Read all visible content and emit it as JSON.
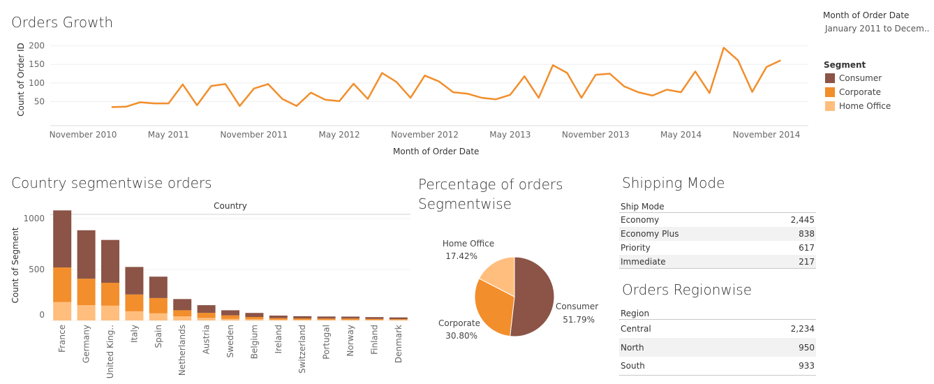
{
  "growth": {
    "title": "Orders Growth",
    "ylabel": "Count of Order ID",
    "xlabel": "Month of Order Date",
    "yticks": [
      200,
      150,
      100,
      50
    ],
    "xticks": [
      "November 2010",
      "May 2011",
      "November 2011",
      "May 2012",
      "November 2012",
      "May 2013",
      "November 2013",
      "May 2014",
      "November 2014"
    ]
  },
  "filter": {
    "title": "Month of Order Date",
    "value": "January 2011 to Decem.."
  },
  "legend": {
    "title": "Segment",
    "items": [
      {
        "label": "Consumer",
        "color": "#8b5446"
      },
      {
        "label": "Corporate",
        "color": "#f28e2b"
      },
      {
        "label": "Home Office",
        "color": "#ffbe7d"
      }
    ]
  },
  "country": {
    "title": "Country segmentwise orders",
    "header": "Country",
    "ylabel": "Count of Segment",
    "yticks": [
      1000,
      500,
      0
    ]
  },
  "pie": {
    "title_line1": "Percentage of orders",
    "title_line2": "Segmentwise",
    "labels": [
      {
        "name": "Home Office",
        "pct": "17.42%"
      },
      {
        "name": "Consumer",
        "pct": "51.79%"
      },
      {
        "name": "Corporate",
        "pct": "30.80%"
      }
    ]
  },
  "shipping": {
    "title": "Shipping Mode",
    "header": "Ship Mode",
    "rows": [
      {
        "mode": "Economy",
        "count": "2,445"
      },
      {
        "mode": "Economy Plus",
        "count": "838"
      },
      {
        "mode": "Priority",
        "count": "617"
      },
      {
        "mode": "Immediate",
        "count": "217"
      }
    ]
  },
  "region": {
    "title": "Orders Regionwise",
    "header": "Region",
    "rows": [
      {
        "region": "Central",
        "count": "2,234"
      },
      {
        "region": "North",
        "count": "950"
      },
      {
        "region": "South",
        "count": "933"
      }
    ]
  },
  "chart_data": [
    {
      "type": "line",
      "title": "Orders Growth",
      "xlabel": "Month of Order Date",
      "ylabel": "Count of Order ID",
      "ylim": [
        0,
        220
      ],
      "x": [
        "2011-01",
        "2011-02",
        "2011-03",
        "2011-04",
        "2011-05",
        "2011-06",
        "2011-07",
        "2011-08",
        "2011-09",
        "2011-10",
        "2011-11",
        "2011-12",
        "2012-01",
        "2012-02",
        "2012-03",
        "2012-04",
        "2012-05",
        "2012-06",
        "2012-07",
        "2012-08",
        "2012-09",
        "2012-10",
        "2012-11",
        "2012-12",
        "2013-01",
        "2013-02",
        "2013-03",
        "2013-04",
        "2013-05",
        "2013-06",
        "2013-07",
        "2013-08",
        "2013-09",
        "2013-10",
        "2013-11",
        "2013-12",
        "2014-01",
        "2014-02",
        "2014-03",
        "2014-04",
        "2014-05",
        "2014-06",
        "2014-07",
        "2014-08",
        "2014-09",
        "2014-10",
        "2014-11",
        "2014-12"
      ],
      "series": [
        {
          "values": [
            35,
            36,
            48,
            45,
            45,
            96,
            40,
            92,
            97,
            38,
            85,
            97,
            57,
            38,
            74,
            55,
            51,
            98,
            57,
            127,
            103,
            60,
            120,
            104,
            75,
            71,
            60,
            56,
            68,
            118,
            60,
            148,
            127,
            60,
            122,
            125,
            91,
            75,
            66,
            82,
            75,
            131,
            73,
            195,
            161,
            76,
            143,
            161
          ]
        }
      ]
    },
    {
      "type": "bar",
      "title": "Country segmentwise orders",
      "ylabel": "Count of Segment",
      "ylim": [
        0,
        1050
      ],
      "categories": [
        "France",
        "Germany",
        "United King..",
        "Italy",
        "Spain",
        "Netherlands",
        "Austria",
        "Sweden",
        "Belgium",
        "Ireland",
        "Switzerland",
        "Portugal",
        "Norway",
        "Finland",
        "Denmark"
      ],
      "series": [
        {
          "name": "Home Office",
          "values": [
            180,
            150,
            145,
            90,
            70,
            40,
            25,
            15,
            12,
            8,
            7,
            7,
            7,
            5,
            5
          ]
        },
        {
          "name": "Corporate",
          "values": [
            340,
            260,
            225,
            165,
            150,
            60,
            50,
            35,
            22,
            15,
            13,
            12,
            12,
            10,
            8
          ]
        },
        {
          "name": "Consumer",
          "values": [
            560,
            475,
            420,
            270,
            210,
            110,
            75,
            50,
            40,
            25,
            22,
            20,
            19,
            18,
            17
          ]
        }
      ]
    },
    {
      "type": "pie",
      "title": "Percentage of orders Segmentwise",
      "categories": [
        "Consumer",
        "Corporate",
        "Home Office"
      ],
      "values": [
        51.79,
        30.8,
        17.42
      ]
    }
  ]
}
